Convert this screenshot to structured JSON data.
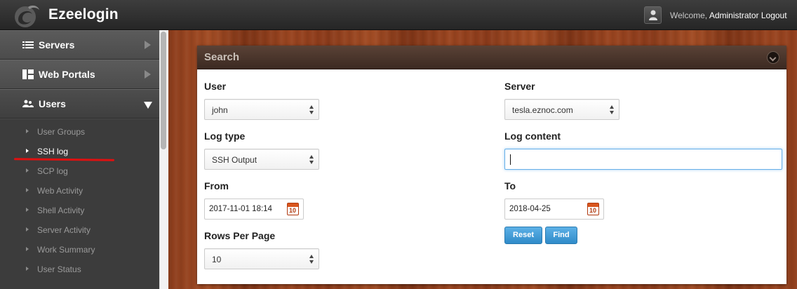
{
  "header": {
    "brand": "Ezeelogin",
    "welcome": "Welcome,",
    "user_link": "Administrator",
    "logout": "Logout"
  },
  "sidebar": {
    "items": [
      {
        "label": "Servers",
        "icon": "list-icon"
      },
      {
        "label": "Web Portals",
        "icon": "portal-icon"
      },
      {
        "label": "Users",
        "icon": "users-icon"
      }
    ],
    "subitems": [
      {
        "label": "User Groups"
      },
      {
        "label": "SSH log"
      },
      {
        "label": "SCP log"
      },
      {
        "label": "Web Activity"
      },
      {
        "label": "Shell Activity"
      },
      {
        "label": "Server Activity"
      },
      {
        "label": "Work Summary"
      },
      {
        "label": "User Status"
      }
    ]
  },
  "search": {
    "title": "Search",
    "user_label": "User",
    "user_value": "john",
    "server_label": "Server",
    "server_value": "tesla.eznoc.com",
    "logtype_label": "Log type",
    "logtype_value": "SSH Output",
    "logcontent_label": "Log content",
    "logcontent_value": "",
    "from_label": "From",
    "from_value": "2017-11-01 18:14",
    "to_label": "To",
    "to_value": "2018-04-25",
    "rows_label": "Rows Per Page",
    "rows_value": "10",
    "reset_label": "Reset",
    "find_label": "Find",
    "calendar_day": "10"
  },
  "colors": {
    "accent_blue": "#2f8bc9",
    "annotation_red": "#e01010"
  }
}
